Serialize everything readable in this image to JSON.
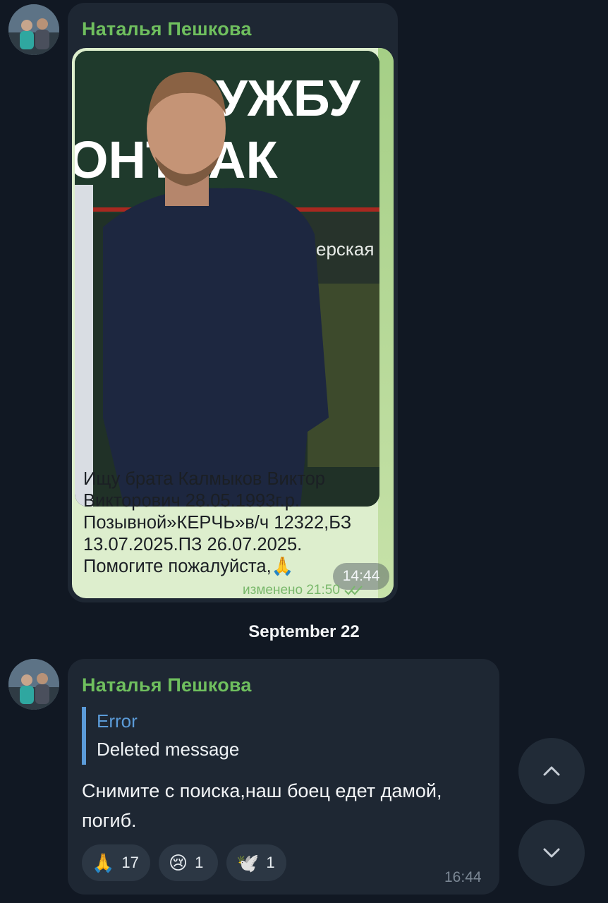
{
  "colors": {
    "background": "#111823",
    "bubble": "#1e2733",
    "sender_name": "#6fbf5e",
    "reply_accent": "#5b9bd8",
    "photo_caption_bg": "#ddeecd"
  },
  "message1": {
    "sender": "Наталья Пешкова",
    "photo_sign_top": "УЖБУ",
    "photo_sign_mid": "ОНТРАК",
    "photo_sign_small": "ерская",
    "caption": "Ищу брата Калмыков Виктор\nВикторович 28.05.1993г.р.\nПозывной»КЕРЧЬ»в/ч 12322,БЗ\n13.07.2025.ПЗ 26.07.2025.\nПомогите пожалуйста,🙏",
    "time": "14:44",
    "edited_label": "изменено 21:50"
  },
  "date_separator": "September 22",
  "message2": {
    "sender": "Наталья Пешкова",
    "reply_title": "Error",
    "reply_text": "Deleted message",
    "text": "Снимите с поиска,наш боец едет дамой,\nпогиб.",
    "time": "16:44",
    "reactions": [
      {
        "emoji": "🙏",
        "count": "17"
      },
      {
        "emoji": "😢",
        "count": "1"
      },
      {
        "emoji": "🕊️",
        "count": "1"
      }
    ]
  },
  "nav": {
    "scroll_up_icon": "chevron-up-icon",
    "scroll_down_icon": "chevron-down-icon"
  }
}
